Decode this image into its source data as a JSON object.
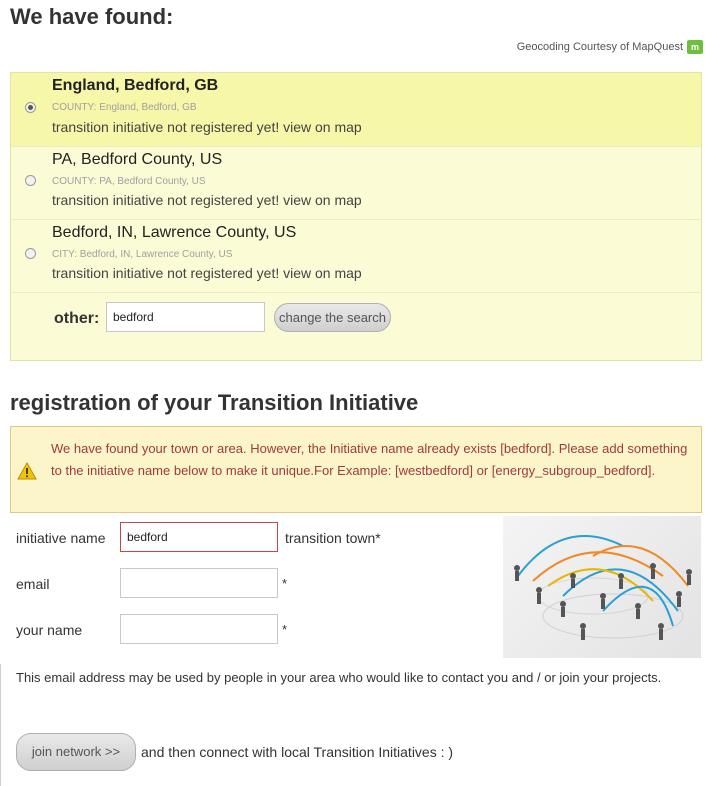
{
  "header": {
    "title": "We have found:"
  },
  "geocoding": {
    "text": "Geocoding Courtesy of MapQuest",
    "icon": "mapquest-logo-icon"
  },
  "results": [
    {
      "place": "England, Bedford, GB",
      "county": "COUNTY: England, Bedford, GB",
      "note": "transition initiative not registered yet!",
      "map_link": "view on map",
      "selected": true
    },
    {
      "place": "PA, Bedford County, US",
      "county": "COUNTY: PA, Bedford County, US",
      "note": "transition initiative not registered yet!",
      "map_link": "view on map",
      "selected": false
    },
    {
      "place": "Bedford, IN, Lawrence County, US",
      "county": "CITY: Bedford, IN, Lawrence County, US",
      "note": "transition initiative not registered yet!",
      "map_link": "view on map",
      "selected": false
    }
  ],
  "other": {
    "label": "other:",
    "value": "bedford",
    "button": "change the search"
  },
  "registration": {
    "title": "registration of your Transition Initiative",
    "warning": "We have found your town or area. However, the Initiative name already exists [bedford]. Please add something to the initiative name below to make it unique.For Example: [westbedford] or [energy_subgroup_bedford].",
    "initiative_label": "initiative name",
    "initiative_value": "bedford",
    "initiative_suffix": "transition town*",
    "email_label": "email",
    "name_label": "your name",
    "required_mark": "*",
    "info": "This email address may be used by people in your area who would like to contact you and / or join your projects.",
    "join_button": "join network >>",
    "join_text": "and then connect with local Transition Initiatives : )"
  },
  "colors": {
    "selected_row": "#f7f7a9",
    "row": "#fbfbd6",
    "warning_text": "#a03b3b",
    "error_border": "#c84545"
  }
}
